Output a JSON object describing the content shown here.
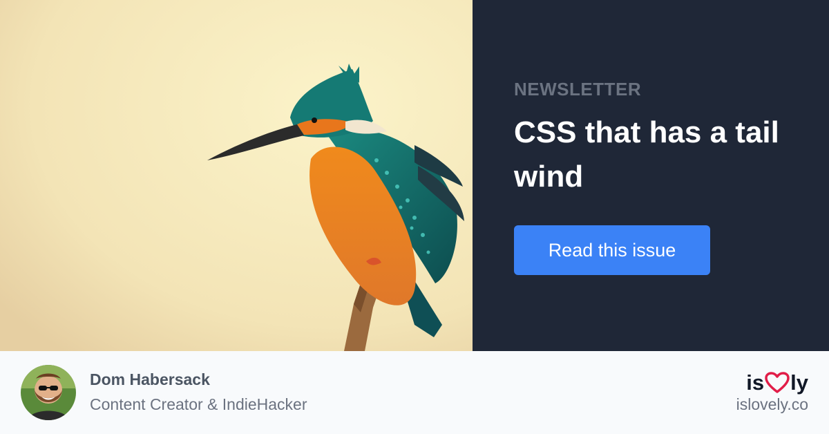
{
  "hero": {
    "image_alt": "Kingfisher perched on a branch"
  },
  "panel": {
    "eyebrow": "NEWSLETTER",
    "title": "CSS that has a tail wind",
    "cta_label": "Read this issue"
  },
  "author": {
    "name": "Dom Habersack",
    "role": "Content Creator & IndieHacker"
  },
  "brand": {
    "logo_prefix": "is",
    "logo_icon": "heart-icon",
    "logo_suffix": "ly",
    "site": "islovely.co"
  },
  "colors": {
    "panel_bg": "#1f2737",
    "accent": "#3b82f6",
    "heart": "#e11d48"
  }
}
